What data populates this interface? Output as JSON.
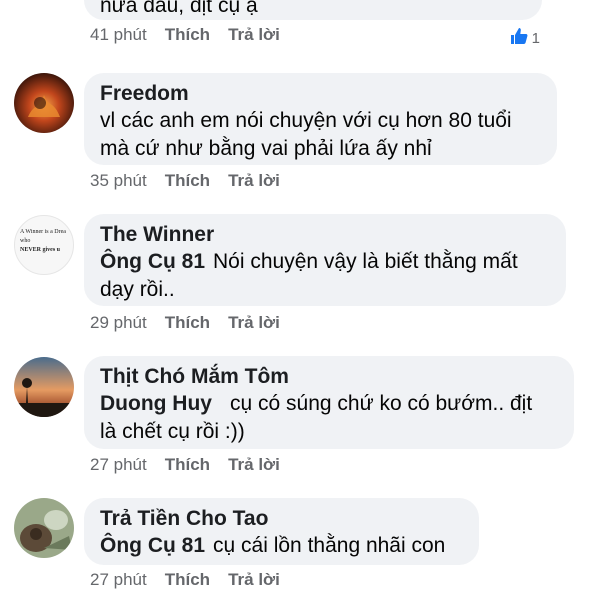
{
  "comments": [
    {
      "text": "nửa đầu, địt cụ ạ",
      "time": "41 phút",
      "like_label": "Thích",
      "reply_label": "Trả lời",
      "reaction_count": "1",
      "reaction_icon": "like-thumb-icon",
      "reaction_color": "#1877f2"
    },
    {
      "author": "Freedom",
      "line1": "vl các anh em nói chuyện với cụ hơn 80 tuổi",
      "line2": "mà cứ như bằng vai phải lứa ấy nhỉ",
      "time": "35 phút",
      "like_label": "Thích",
      "reply_label": "Trả lời"
    },
    {
      "author": "The Winner",
      "tag": "Ông Cụ 81",
      "line1": "Nói chuyện vậy là biết thằng mất",
      "line2": "dạy rồi..",
      "time": "29 phút",
      "like_label": "Thích",
      "reply_label": "Trả lời",
      "avatar_text": [
        "A Winner is a Drea",
        "who",
        "NEVER gives u"
      ]
    },
    {
      "author": "Thịt Chó Mắm Tôm",
      "tag": "Duong Huy",
      "line1": "cụ có súng chứ ko có bướm.. địt",
      "line2": "là chết cụ rồi :))",
      "time": "27 phút",
      "like_label": "Thích",
      "reply_label": "Trả lời"
    },
    {
      "author": "Trả Tiền Cho Tao",
      "tag": "Ông Cụ 81",
      "line1": "cụ cái lồn thằng nhãi con",
      "time": "27 phút",
      "like_label": "Thích",
      "reply_label": "Trả lời"
    }
  ],
  "colors": {
    "bubble": "#f0f2f5",
    "meta_text": "#65676b",
    "like_blue": "#1877f2"
  }
}
